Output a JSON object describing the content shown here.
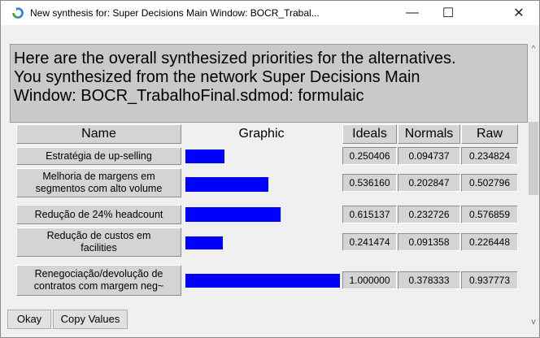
{
  "window": {
    "title": "New synthesis for: Super Decisions Main Window: BOCR_Trabal...",
    "minimize_glyph": "—",
    "maximize_glyph": "☐",
    "close_glyph": "✕"
  },
  "header": {
    "line1": "Here are the overall synthesized priorities for the alternatives.",
    "line2": "You synthesized from the network Super Decisions Main",
    "line3": "Window: BOCR_TrabalhoFinal.sdmod: formulaic"
  },
  "table": {
    "columns": [
      "Name",
      "Graphic",
      "Ideals",
      "Normals",
      "Raw"
    ],
    "rows": [
      {
        "name_line1": "Estratégia de up-selling",
        "name_line2": "",
        "ideal": "0.250406",
        "normal": "0.094737",
        "raw": "0.234824",
        "ideal_value": 0.250406
      },
      {
        "name_line1": "Melhoria de margens em",
        "name_line2": "segmentos com alto volume",
        "ideal": "0.536160",
        "normal": "0.202847",
        "raw": "0.502796",
        "ideal_value": 0.53616
      },
      {
        "name_line1": "Redução de 24% headcount",
        "name_line2": "",
        "ideal": "0.615137",
        "normal": "0.232726",
        "raw": "0.576859",
        "ideal_value": 0.615137
      },
      {
        "name_line1": "Redução de custos em",
        "name_line2": "facilities",
        "ideal": "0.241474",
        "normal": "0.091358",
        "raw": "0.226448",
        "ideal_value": 0.241474
      },
      {
        "name_line1": "Renegociação/devolução de",
        "name_line2": "contratos com margem neg~",
        "ideal": "1.000000",
        "normal": "0.378333",
        "raw": "0.937773",
        "ideal_value": 1.0
      }
    ]
  },
  "buttons": {
    "okay": "Okay",
    "copy_values": "Copy Values"
  },
  "scrollbar": {
    "up_glyph": "^",
    "down_glyph": "v"
  },
  "colors": {
    "bar": "#0000ff",
    "header_bg": "#c9c9c9",
    "app_icon": "#2a7de1"
  }
}
